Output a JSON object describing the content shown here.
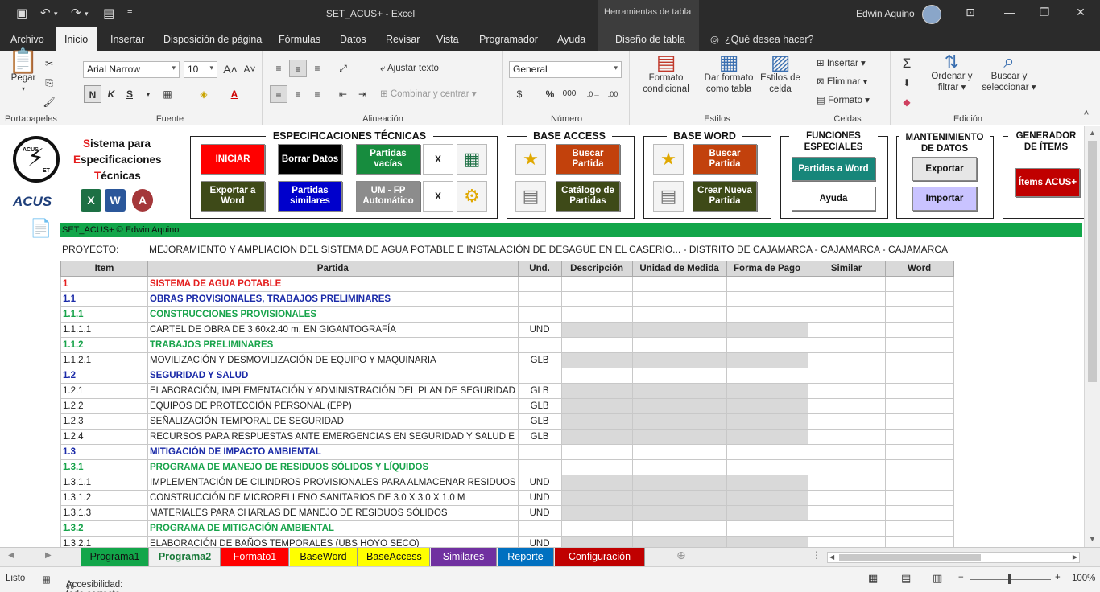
{
  "window": {
    "doc_title": "SET_ACUS+  -  Excel",
    "tools_title": "Herramientas de tabla",
    "user": "Edwin Aquino"
  },
  "menu": {
    "tabs": [
      "Archivo",
      "Inicio",
      "Insertar",
      "Disposición de página",
      "Fórmulas",
      "Datos",
      "Revisar",
      "Vista",
      "Programador",
      "Ayuda"
    ],
    "design_tab": "Diseño de tabla",
    "tell_me": "¿Qué desea hacer?"
  },
  "ribbon": {
    "clipboard": {
      "paste": "Pegar",
      "label": "Portapapeles"
    },
    "font": {
      "name": "Arial Narrow",
      "size": "10",
      "label": "Fuente",
      "bold": "N",
      "italic": "K",
      "underline": "S"
    },
    "alignment": {
      "wrap": "Ajustar texto",
      "merge": "Combinar y centrar",
      "label": "Alineación"
    },
    "number": {
      "format": "General",
      "label": "Número"
    },
    "styles": {
      "conditional_1": "Formato",
      "conditional_2": "condicional",
      "table_1": "Dar formato",
      "table_2": "como tabla",
      "cell_1": "Estilos de",
      "cell_2": "celda",
      "label": "Estilos"
    },
    "cells": {
      "insert": "Insertar",
      "delete": "Eliminar",
      "format": "Formato",
      "label": "Celdas"
    },
    "editing": {
      "sort_1": "Ordenar y",
      "sort_2": "filtrar",
      "find_1": "Buscar y",
      "find_2": "seleccionar",
      "label": "Edición"
    }
  },
  "banner": {
    "logo_top": "ACUS",
    "logo_bottom": "ET",
    "system_title": {
      "line1_first": "S",
      "line1_rest": "istema para",
      "line2_first": "E",
      "line2_rest": "specificaciones",
      "line3_first": "T",
      "line3_rest": "écnicas"
    },
    "acus_brand": "ACUS",
    "app_icons": {
      "excel": "X",
      "word": "W",
      "access": "A"
    },
    "spec": {
      "title": "ESPECIFICACIONES TÉCNICAS",
      "iniciar": "INICIAR",
      "borrar": "Borrar Datos",
      "vacias": "Partidas vacías",
      "x1": "X",
      "exportar": "Exportar a Word",
      "similares": "Partidas similares",
      "um": "UM - FP Automático",
      "x2": "X"
    },
    "access": {
      "title": "BASE ACCESS",
      "buscar": "Buscar Partida",
      "catalogo": "Catálogo de Partidas"
    },
    "word": {
      "title": "BASE WORD",
      "buscar": "Buscar Partida",
      "crear": "Crear Nueva Partida"
    },
    "funciones": {
      "title_1": "FUNCIONES",
      "title_2": "ESPECIALES",
      "partidas_word": "Partidas a Word",
      "ayuda": "Ayuda"
    },
    "mantenimiento": {
      "title_1": "MANTENIMIENTO",
      "title_2": "DE DATOS",
      "exportar": "Exportar",
      "importar": "Importar"
    },
    "generador": {
      "title_1": "GENERADOR",
      "title_2": "DE ÍTEMS",
      "items": "Ítems ACUS+"
    }
  },
  "sheet": {
    "green_bar": "SET_ACUS+ © Edwin Aquino",
    "project_label": "PROYECTO:",
    "project_value": "MEJORAMIENTO Y AMPLIACION DEL SISTEMA DE AGUA POTABLE E INSTALACIÓN DE DESAGÜE EN EL CASERIO... - DISTRITO DE CAJAMARCA - CAJAMARCA - CAJAMARCA",
    "headers": [
      "Item",
      "Partida",
      "Und.",
      "Descripción",
      "Unidad de Medida",
      "Forma de Pago",
      "Similar",
      "Word"
    ],
    "rows": [
      {
        "item": "1",
        "partida": "SISTEMA DE AGUA POTABLE",
        "und": "",
        "level": 1
      },
      {
        "item": "1.1",
        "partida": "OBRAS PROVISIONALES, TRABAJOS PRELIMINARES",
        "und": "",
        "level": 2
      },
      {
        "item": "1.1.1",
        "partida": "CONSTRUCCIONES PROVISIONALES",
        "und": "",
        "level": 3
      },
      {
        "item": "1.1.1.1",
        "partida": "CARTEL DE OBRA DE 3.60x2.40 m, EN GIGANTOGRAFÍA",
        "und": "UND",
        "level": 4
      },
      {
        "item": "1.1.2",
        "partida": "TRABAJOS PRELIMINARES",
        "und": "",
        "level": 3
      },
      {
        "item": "1.1.2.1",
        "partida": "MOVILIZACIÓN Y DESMOVILIZACIÓN DE EQUIPO Y MAQUINARIA",
        "und": "GLB",
        "level": 4
      },
      {
        "item": "1.2",
        "partida": "SEGURIDAD Y SALUD",
        "und": "",
        "level": 2
      },
      {
        "item": "1.2.1",
        "partida": "ELABORACIÓN, IMPLEMENTACIÓN Y ADMINISTRACIÓN DEL PLAN DE SEGURIDAD",
        "und": "GLB",
        "level": 4
      },
      {
        "item": "1.2.2",
        "partida": "EQUIPOS DE PROTECCIÓN PERSONAL (EPP)",
        "und": "GLB",
        "level": 4
      },
      {
        "item": "1.2.3",
        "partida": "SEÑALIZACIÓN TEMPORAL DE SEGURIDAD",
        "und": "GLB",
        "level": 4
      },
      {
        "item": "1.2.4",
        "partida": "RECURSOS PARA RESPUESTAS ANTE EMERGENCIAS EN SEGURIDAD Y SALUD E",
        "und": "GLB",
        "level": 4
      },
      {
        "item": "1.3",
        "partida": "MITIGACIÓN DE IMPACTO AMBIENTAL",
        "und": "",
        "level": 2
      },
      {
        "item": "1.3.1",
        "partida": "PROGRAMA DE MANEJO DE RESIDUOS SÓLIDOS Y LÍQUIDOS",
        "und": "",
        "level": 3
      },
      {
        "item": "1.3.1.1",
        "partida": "IMPLEMENTACIÓN DE CILINDROS PROVISIONALES PARA ALMACENAR RESIDUOS",
        "und": "UND",
        "level": 4
      },
      {
        "item": "1.3.1.2",
        "partida": "CONSTRUCCIÓN DE MICRORELLENO SANITARIOS DE 3.0 X 3.0 X 1.0 M",
        "und": "UND",
        "level": 4
      },
      {
        "item": "1.3.1.3",
        "partida": "MATERIALES PARA CHARLAS DE MANEJO DE RESIDUOS SÓLIDOS",
        "und": "UND",
        "level": 4
      },
      {
        "item": "1.3.2",
        "partida": "PROGRAMA DE MITIGACIÓN AMBIENTAL",
        "und": "",
        "level": 3
      },
      {
        "item": "1.3.2.1",
        "partida": "ELABORACIÓN DE BAÑOS TEMPORALES (UBS HOYO SECO)",
        "und": "UND",
        "level": 4
      }
    ]
  },
  "sheet_tabs": [
    {
      "label": "Programa1",
      "bg": "#12a64a",
      "fg": "#111111"
    },
    {
      "label": "Programa2",
      "bg": "#f0f0f0",
      "fg": "#1a7a3a"
    },
    {
      "label": "Formato1",
      "bg": "#ff0000",
      "fg": "#ffffff"
    },
    {
      "label": "BaseWord",
      "bg": "#ffff00",
      "fg": "#111111"
    },
    {
      "label": "BaseAccess",
      "bg": "#ffff00",
      "fg": "#111111"
    },
    {
      "label": "Similares",
      "bg": "#7030a0",
      "fg": "#ffffff"
    },
    {
      "label": "Reporte",
      "bg": "#0070c0",
      "fg": "#ffffff"
    },
    {
      "label": "Configuración",
      "bg": "#c00000",
      "fg": "#ffffff"
    }
  ],
  "status": {
    "ready": "Listo",
    "accessibility": "Accesibilidad: todo correcto",
    "zoom": "100%"
  }
}
